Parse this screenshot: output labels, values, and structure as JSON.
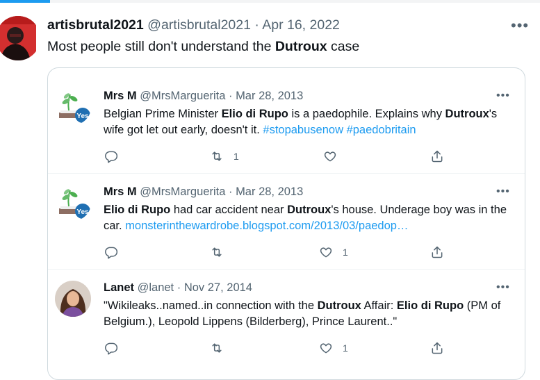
{
  "main_tweet": {
    "author_name": "artisbrutal2021",
    "handle": "@artisbrutal2021",
    "separator": "·",
    "date": "Apr 16, 2022",
    "more": "•••",
    "text_pre": "Most people still don't understand the ",
    "text_bold": "Dutroux",
    "text_post": " case"
  },
  "thread": [
    {
      "name": "Mrs M",
      "handle": "@MrsMarguerita",
      "separator": "·",
      "date": "Mar 28, 2013",
      "more": "•••",
      "text": {
        "p1": "Belgian Prime Minister ",
        "b1": "Elio di Rupo",
        "p2": " is a paedophile. Explains why ",
        "b2": "Dutroux",
        "p3": "'s wife got let out early, doesn't it. ",
        "link1": "#stopabusenow",
        "p4": " ",
        "link2": "#paedobritain"
      },
      "retweets": "1",
      "likes": ""
    },
    {
      "name": "Mrs M",
      "handle": "@MrsMarguerita",
      "separator": "·",
      "date": "Mar 28, 2013",
      "more": "•••",
      "text": {
        "b1": "Elio di Rupo",
        "p1": " had car accident near ",
        "b2": "Dutroux",
        "p2": "'s house. Underage boy was in the car. ",
        "link1": "monsterinthewardrobe.blogspot.com/2013/03/paedop…"
      },
      "retweets": "",
      "likes": "1"
    },
    {
      "name": "Lanet",
      "handle": "@lanet",
      "separator": "·",
      "date": "Nov 27, 2014",
      "more": "•••",
      "text": {
        "p1": "\"Wikileaks..named..in connection with the ",
        "b1": "Dutroux",
        "p2": " Affair: ",
        "b2": "Elio di Rupo",
        "p3": " (PM of Belgium.), Leopold Lippens (Bilderberg), Prince Laurent..\""
      },
      "retweets": "",
      "likes": "1"
    }
  ],
  "icons": {
    "reply": "reply-icon",
    "retweet": "retweet-icon",
    "like": "heart-icon",
    "share": "share-icon",
    "more": "more-icon"
  },
  "colors": {
    "link": "#1d9bf0",
    "muted": "#536471",
    "border": "#cfd9de",
    "main_avatar": "#d32f2f",
    "yes_badge": "#1f6fb2"
  }
}
